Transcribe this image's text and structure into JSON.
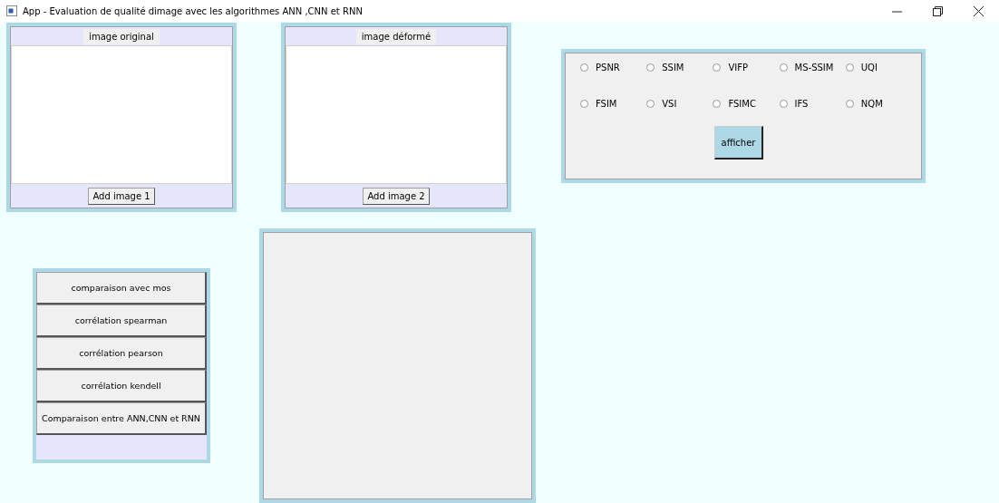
{
  "window": {
    "title": "App - Evaluation de qualité dimage avec les  algorithmes ANN ,CNN et RNN"
  },
  "image_panels": [
    {
      "label": "image original",
      "button": "Add image 1"
    },
    {
      "label": "image déformé",
      "button": "Add image 2"
    }
  ],
  "metrics": [
    {
      "label": "PSNR",
      "selected": false
    },
    {
      "label": "SSIM",
      "selected": false
    },
    {
      "label": "VIFP",
      "selected": false
    },
    {
      "label": "MS-SSIM",
      "selected": false
    },
    {
      "label": "UQI",
      "selected": false
    },
    {
      "label": "FSIM",
      "selected": false
    },
    {
      "label": "VSI",
      "selected": false
    },
    {
      "label": "FSIMC",
      "selected": false
    },
    {
      "label": "IFS",
      "selected": false
    },
    {
      "label": "NQM",
      "selected": false
    }
  ],
  "show_button": "afficher",
  "actions": [
    "comparaison avec mos",
    "corrélation spearman",
    "corrélation pearson",
    "corrélation kendell",
    "Comparaison entre ANN,CNN et RNN"
  ]
}
